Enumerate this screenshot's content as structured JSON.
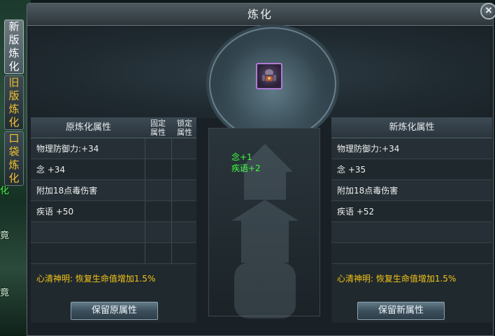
{
  "window": {
    "title": "炼化",
    "close_label": "×"
  },
  "side_tabs": [
    {
      "chars": [
        "新",
        "版",
        "炼",
        "化"
      ],
      "active": true
    },
    {
      "chars": [
        "旧",
        "版",
        "炼",
        "化"
      ],
      "active": false
    },
    {
      "chars": [
        "口",
        "袋",
        "炼",
        "化"
      ],
      "active": false
    }
  ],
  "world_fragments": {
    "a": "化",
    "b": "竟",
    "c": "竟"
  },
  "item_slot": {
    "icon": "armor-item-icon"
  },
  "left_panel": {
    "header": "原炼化属性",
    "col_fixed": "固定\n属性",
    "col_locked": "锁定\n属性",
    "rows": [
      "物理防御力:+34",
      "念 +34",
      "附加18点毒伤害",
      "疾语 +50",
      "",
      ""
    ],
    "bonus": "心清神明: 恢复生命值增加1.5%",
    "button": "保留原属性"
  },
  "right_panel": {
    "header": "新炼化属性",
    "rows": [
      "物理防御力:+34",
      "念 +35",
      "附加18点毒伤害",
      "疾语 +52",
      "",
      ""
    ],
    "bonus": "心清神明: 恢复生命值增加1.5%",
    "button": "保留新属性"
  },
  "center": {
    "changes": [
      "念+1",
      "疾语+2"
    ]
  },
  "colors": {
    "bonus_gold": "#f5c518",
    "change_green": "#3cff3c",
    "slot_border_purple": "#b07ad6"
  }
}
